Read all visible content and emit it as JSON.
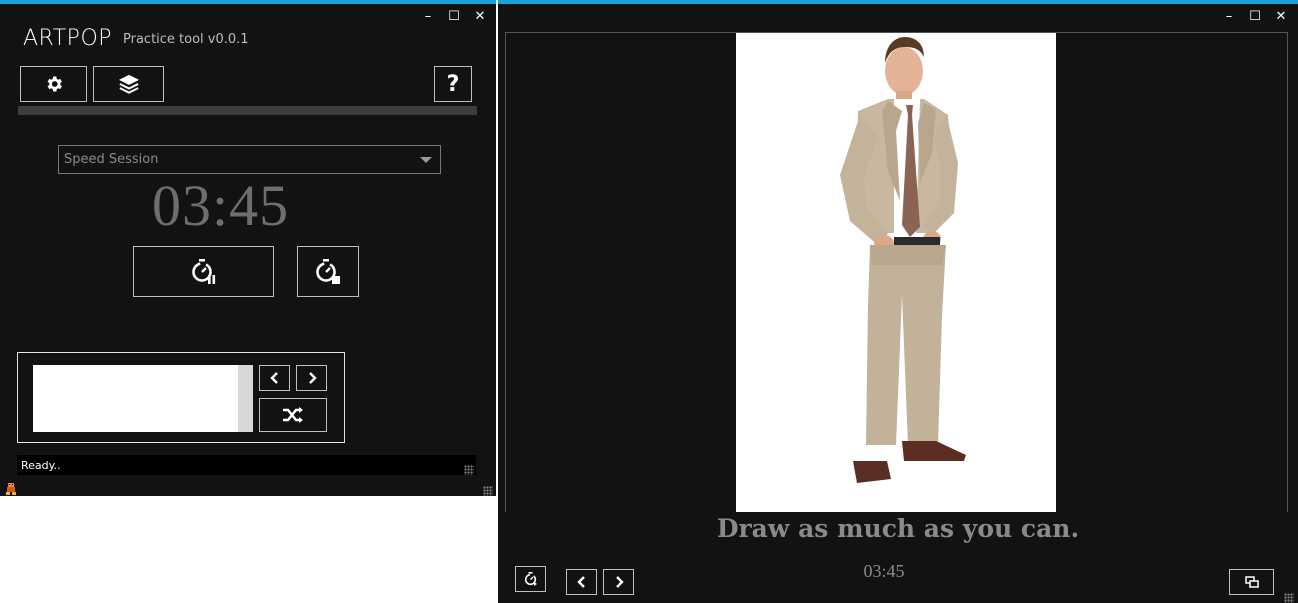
{
  "left_window": {
    "app_title": "ARTPOP",
    "app_subtitle": "Practice tool v0.0.1",
    "controls": {
      "minimize": "–",
      "maximize": "☐",
      "close": "✕"
    },
    "toolbar": {
      "settings_icon": "gear-icon",
      "layers_icon": "layers-icon",
      "help_label": "?"
    },
    "session_progress": 0,
    "session_select": {
      "selected": "Speed Session"
    },
    "timer": "03:45",
    "timer_controls": {
      "pause_icon": "stopwatch-pause-icon",
      "stop_icon": "stopwatch-stop-icon"
    },
    "list_nav": {
      "prev_icon": "chevron-left-icon",
      "next_icon": "chevron-right-icon",
      "shuffle_icon": "shuffle-icon"
    },
    "status_text": "Ready.."
  },
  "right_window": {
    "controls": {
      "minimize": "–",
      "maximize": "☐",
      "close": "✕"
    },
    "caption": "Draw as much as you can.",
    "timer": "03:45",
    "bottom_controls": {
      "timer_icon": "stopwatch-icon",
      "prev_icon": "chevron-left-icon",
      "next_icon": "chevron-right-icon",
      "window_icon": "restore-window-icon"
    }
  },
  "colors": {
    "accent": "#1aa3d8",
    "background": "#121212",
    "muted_text": "#8a8a8a"
  }
}
